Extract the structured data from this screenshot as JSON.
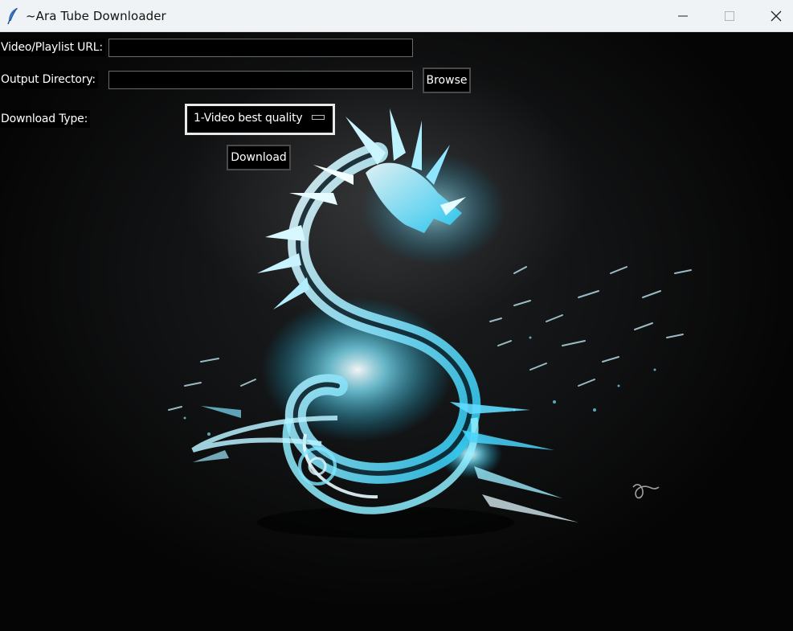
{
  "window": {
    "title": "~Ara Tube Downloader",
    "controls": [
      "minimize-icon",
      "maximize-icon",
      "close-icon"
    ]
  },
  "form": {
    "url_label": "Video/Playlist URL:",
    "url_value": "",
    "output_label": "Output Directory:",
    "output_value": "",
    "browse_label": "Browse",
    "type_label": "Download Type:",
    "type_selected": "1-Video best quality",
    "download_label": "Download"
  },
  "background": {
    "description_icon": "dragon-icon",
    "accent": "#5fe0ff"
  }
}
